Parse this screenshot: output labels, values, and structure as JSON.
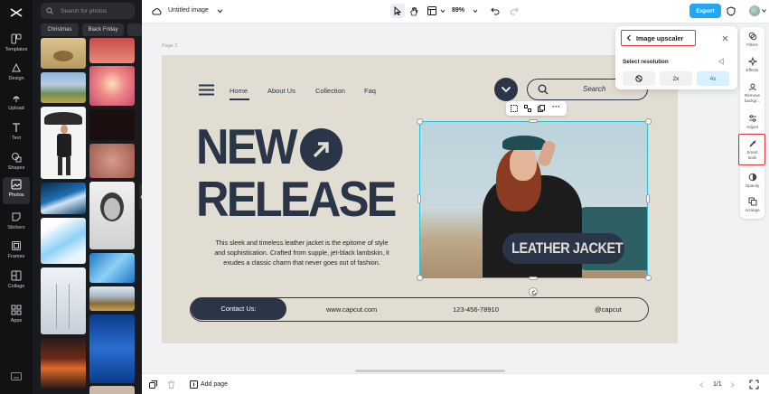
{
  "rail": {
    "items": [
      {
        "label": "Templates",
        "icon": "templates-icon"
      },
      {
        "label": "Design",
        "icon": "design-icon"
      },
      {
        "label": "Upload",
        "icon": "upload-icon"
      },
      {
        "label": "Text",
        "icon": "text-icon"
      },
      {
        "label": "Shapes",
        "icon": "shapes-icon"
      },
      {
        "label": "Photos",
        "icon": "photos-icon"
      },
      {
        "label": "Stickers",
        "icon": "stickers-icon"
      },
      {
        "label": "Frames",
        "icon": "frames-icon"
      },
      {
        "label": "Collage",
        "icon": "collage-icon"
      },
      {
        "label": "Apps",
        "icon": "apps-icon"
      }
    ],
    "active": "Photos"
  },
  "panel": {
    "search_placeholder": "Search for photos",
    "chips": [
      "Christmas",
      "Black Friday"
    ]
  },
  "topbar": {
    "doc_title": "Untitled image",
    "zoom": "89%",
    "export_label": "Export"
  },
  "canvas": {
    "page_label": "Page 1",
    "nav": [
      "Home",
      "About Us",
      "Collection",
      "Faq"
    ],
    "search_text": "Search",
    "headline_line1": "NEW",
    "headline_line2": "RELEASE",
    "body_text": [
      "This sleek and timeless leather jacket is the epitome of style",
      "and sophistication. Crafted from supple, jet-black lambskin, it",
      "exudes a classic charm that never goes out of fashion."
    ],
    "image_caption": "LEATHER JACKET",
    "contact_label": "Contact Us:",
    "website": "www.capcut.com",
    "phone": "123-456-78910",
    "handle": "@capcut"
  },
  "popup": {
    "title": "Image upscaler",
    "section_label": "Select resolution",
    "options": [
      "2x",
      "4x"
    ],
    "selected": "4x"
  },
  "rightrail": {
    "items": [
      {
        "label": "Filters",
        "icon": "filters-icon"
      },
      {
        "label": "Effects",
        "icon": "effects-icon"
      },
      {
        "label": "Remove backgr...",
        "icon": "remove-background-icon"
      },
      {
        "label": "Adjust",
        "icon": "adjust-icon"
      },
      {
        "label": "Smart tools",
        "icon": "smart-tools-icon"
      },
      {
        "label": "Opacity",
        "icon": "opacity-icon"
      },
      {
        "label": "Arrange",
        "icon": "arrange-icon"
      }
    ]
  },
  "bottombar": {
    "add_page_label": "Add page",
    "page_indicator": "1/1"
  },
  "colors": {
    "accent": "#20a7f5",
    "navy": "#2b3548",
    "canvas_bg": "#e2ddd3",
    "highlight": "#e0343b"
  }
}
